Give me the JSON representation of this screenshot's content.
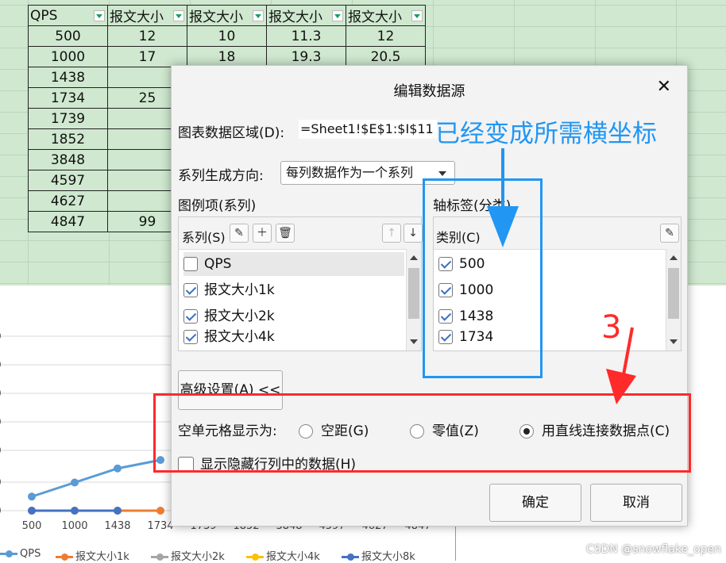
{
  "sheet": {
    "headers": [
      "QPS",
      "报文大小",
      "报文大小",
      "报文大小",
      "报文大小"
    ],
    "rows": [
      [
        "500",
        "12",
        "10",
        "11.3",
        "12"
      ],
      [
        "1000",
        "17",
        "18",
        "19.3",
        "20.5"
      ],
      [
        "1438",
        "",
        "",
        "",
        ""
      ],
      [
        "1734",
        "25",
        "",
        "",
        ""
      ],
      [
        "1739",
        "",
        "",
        "",
        ""
      ],
      [
        "1852",
        "",
        "",
        "",
        ""
      ],
      [
        "3848",
        "",
        "",
        "",
        ""
      ],
      [
        "4597",
        "",
        "",
        "",
        ""
      ],
      [
        "4627",
        "",
        "",
        "",
        ""
      ],
      [
        "4847",
        "99",
        "",
        "",
        ""
      ]
    ]
  },
  "chart_data": {
    "type": "line",
    "categories": [
      "500",
      "1000",
      "1438",
      "1734",
      "1739",
      "1852",
      "3848",
      "4597",
      "4627",
      "4847"
    ],
    "series": [
      {
        "name": "QPS",
        "color": "#5b9bd5",
        "values": [
          5,
          10,
          15,
          18,
          null,
          null,
          null,
          null,
          null,
          null
        ]
      },
      {
        "name": "报文大小1k",
        "color": "#ed7d31",
        "values": [
          0,
          0,
          0,
          0,
          null,
          null,
          null,
          null,
          null,
          null
        ]
      },
      {
        "name": "报文大小2k",
        "color": "#a5a5a5",
        "values": [
          null,
          null,
          null,
          null,
          null,
          null,
          null,
          null,
          null,
          null
        ]
      },
      {
        "name": "报文大小4k",
        "color": "#ffc000",
        "values": [
          null,
          null,
          null,
          null,
          null,
          null,
          null,
          null,
          null,
          null
        ]
      },
      {
        "name": "报文大小8k",
        "color": "#4472c4",
        "values": [
          0,
          0,
          0,
          null,
          null,
          null,
          null,
          null,
          null,
          null
        ]
      }
    ],
    "legend": "bottom",
    "grid": true
  },
  "dialog": {
    "title": "编辑数据源",
    "close_label": "✕",
    "range_label": "图表数据区域(D):",
    "range_value": "=Sheet1!$E$1:$I$11",
    "direction_label": "系列生成方向:",
    "direction_value": "每列数据作为一个系列",
    "legend_group_label": "图例项(系列)",
    "series_label": "系列(S)",
    "series_items": [
      {
        "label": "QPS",
        "checked": false
      },
      {
        "label": "报文大小1k",
        "checked": true
      },
      {
        "label": "报文大小2k",
        "checked": true
      },
      {
        "label": "报文大小4k",
        "checked": true
      }
    ],
    "axis_group_label": "轴标签(分类)",
    "category_label": "类别(C)",
    "category_items": [
      {
        "label": "500",
        "checked": true
      },
      {
        "label": "1000",
        "checked": true
      },
      {
        "label": "1438",
        "checked": true
      },
      {
        "label": "1734",
        "checked": true
      }
    ],
    "advanced_button": "高级设置(A) <<",
    "empty_cell_label": "空单元格显示为:",
    "radio_options": [
      {
        "label": "空距(G)",
        "selected": false
      },
      {
        "label": "零值(Z)",
        "selected": false
      },
      {
        "label": "用直线连接数据点(C)",
        "selected": true
      }
    ],
    "hidden_data_label": "显示隐藏行列中的数据(H)",
    "ok_button": "确定",
    "cancel_button": "取消"
  },
  "annotations": {
    "blue_text": "已经变成所需横坐标",
    "red_number": "3",
    "blue_color": "#2196f3",
    "red_color": "#ff2a2a"
  },
  "watermark": "CSDN @snowflake_open"
}
